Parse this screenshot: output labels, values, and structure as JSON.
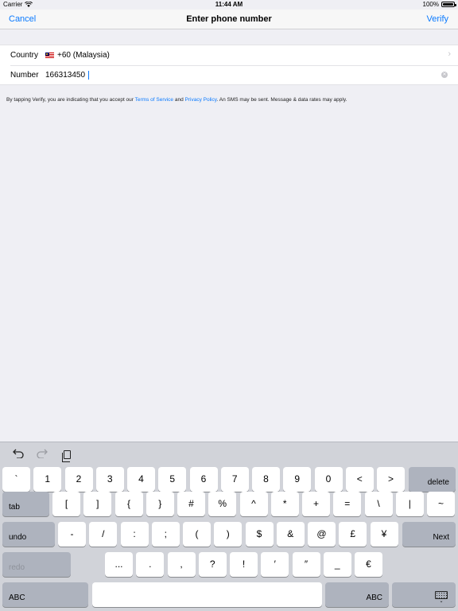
{
  "status_bar": {
    "carrier": "Carrier",
    "time": "11:44 AM",
    "battery": "100%"
  },
  "nav": {
    "cancel": "Cancel",
    "title": "Enter phone number",
    "verify": "Verify"
  },
  "form": {
    "country_label": "Country",
    "country_value": "+60 (Malaysia)",
    "number_label": "Number",
    "number_value": "166313450"
  },
  "terms": {
    "prefix": "By tapping Verify, you are indicating that you accept our ",
    "tos": "Terms of Service",
    "and": " and ",
    "privacy": "Privacy Policy",
    "suffix": ". An SMS may be sent. Message & data rates may apply."
  },
  "keyboard": {
    "row1": [
      "`",
      "1",
      "2",
      "3",
      "4",
      "5",
      "6",
      "7",
      "8",
      "9",
      "0",
      "<",
      ">"
    ],
    "delete": "delete",
    "tab": "tab",
    "row2": [
      "[",
      "]",
      "{",
      "}",
      "#",
      "%",
      "^",
      "*",
      "+",
      "=",
      "\\",
      "|",
      "~"
    ],
    "undo": "undo",
    "row3": [
      "-",
      "/",
      ":",
      ";",
      "(",
      ")",
      "$",
      "&",
      "@",
      "£",
      "¥"
    ],
    "next": "Next",
    "redo": "redo",
    "row4": [
      "...",
      ".",
      ",",
      "?",
      "!",
      "′",
      "″",
      "_",
      "€"
    ],
    "abc_left": "ABC",
    "abc_right": "ABC"
  }
}
